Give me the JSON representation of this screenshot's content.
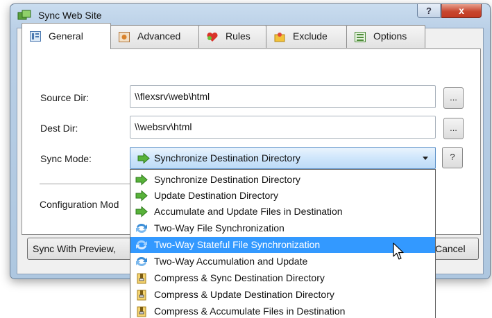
{
  "window": {
    "title": "Sync Web Site",
    "help_label": "?",
    "close_label": "x"
  },
  "tabs": [
    {
      "label": "General",
      "icon": "general-tab-icon",
      "active": true
    },
    {
      "label": "Advanced",
      "icon": "advanced-tab-icon",
      "active": false
    },
    {
      "label": "Rules",
      "icon": "rules-tab-icon",
      "active": false
    },
    {
      "label": "Exclude",
      "icon": "exclude-tab-icon",
      "active": false
    },
    {
      "label": "Options",
      "icon": "options-tab-icon",
      "active": false
    }
  ],
  "form": {
    "source_label": "Source Dir:",
    "source_value": "\\\\flexsrv\\web\\html",
    "dest_label": "Dest Dir:",
    "dest_value": "\\\\websrv\\html",
    "browse_label": "...",
    "sync_mode_label": "Sync Mode:",
    "sync_mode_value": "Synchronize Destination Directory",
    "sync_help_label": "?",
    "config_label": "Configuration Mod"
  },
  "buttons": {
    "sync_preview": "Sync With Preview,",
    "cancel": "Cancel"
  },
  "dropdown": {
    "options": [
      {
        "label": "Synchronize Destination Directory",
        "icon": "green-arrow-icon",
        "selected": false
      },
      {
        "label": "Update Destination Directory",
        "icon": "green-arrow-icon",
        "selected": false
      },
      {
        "label": "Accumulate and Update Files in Destination",
        "icon": "green-arrow-icon",
        "selected": false
      },
      {
        "label": "Two-Way File Synchronization",
        "icon": "two-way-sync-icon",
        "selected": false
      },
      {
        "label": "Two-Way Stateful File Synchronization",
        "icon": "two-way-sync-icon",
        "selected": true
      },
      {
        "label": "Two-Way Accumulation and Update",
        "icon": "two-way-sync-icon",
        "selected": false
      },
      {
        "label": "Compress & Sync Destination Directory",
        "icon": "compress-icon",
        "selected": false
      },
      {
        "label": "Compress & Update Destination Directory",
        "icon": "compress-icon",
        "selected": false
      },
      {
        "label": "Compress & Accumulate Files in Destination",
        "icon": "compress-icon",
        "selected": false
      }
    ]
  },
  "colors": {
    "selection": "#3399ff",
    "combo_border": "#5f92c8",
    "close_button": "#c8472f"
  }
}
